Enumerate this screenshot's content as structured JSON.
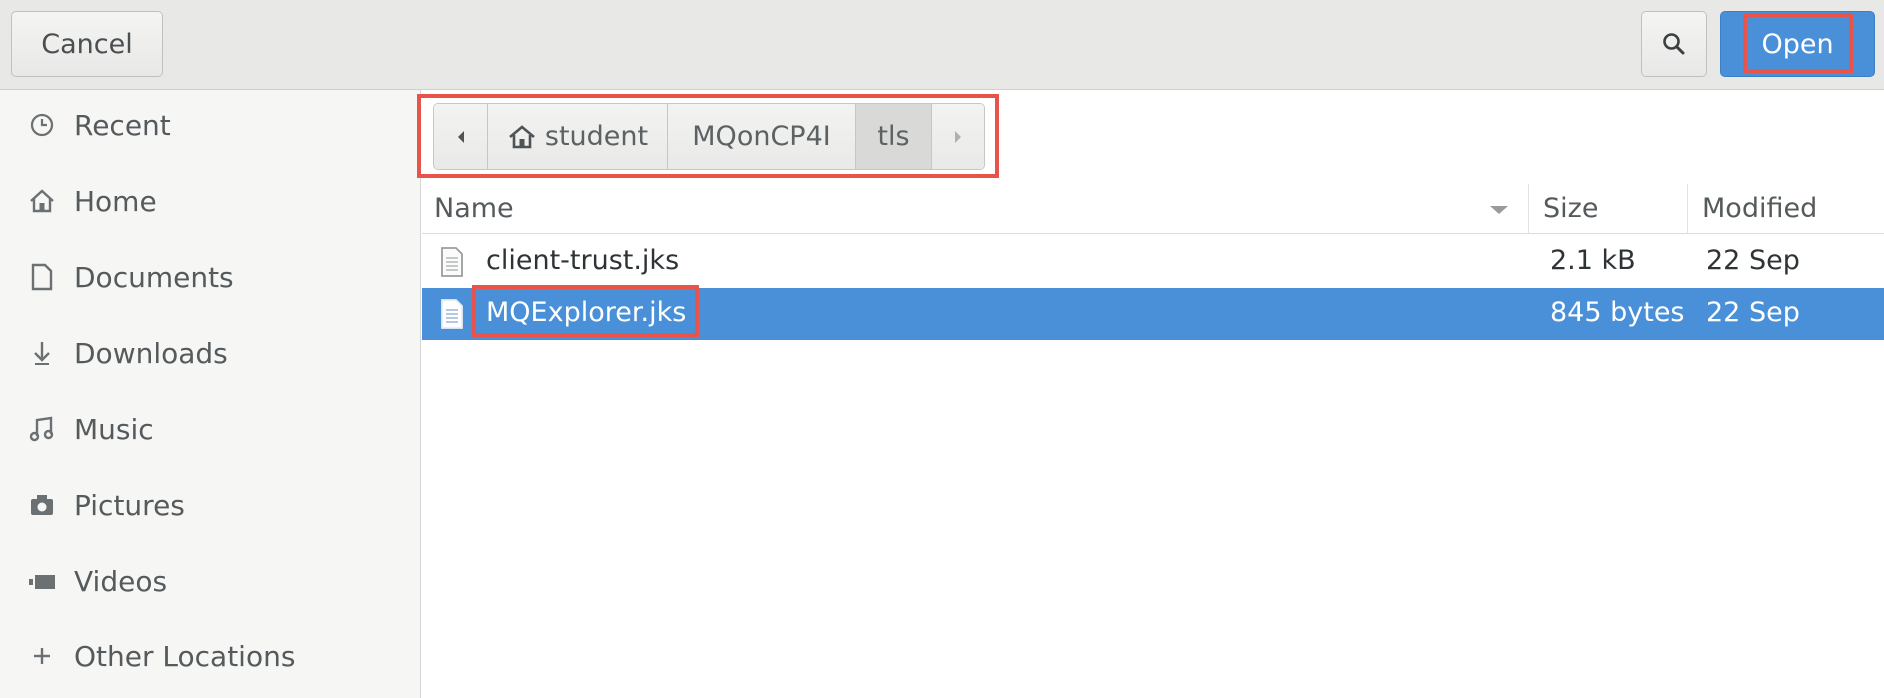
{
  "header": {
    "cancel_label": "Cancel",
    "search_icon": "search-icon",
    "open_label": "Open"
  },
  "sidebar": {
    "items": [
      {
        "label": "Recent",
        "icon": "clock-icon"
      },
      {
        "label": "Home",
        "icon": "home-icon"
      },
      {
        "label": "Documents",
        "icon": "document-icon"
      },
      {
        "label": "Downloads",
        "icon": "download-icon"
      },
      {
        "label": "Music",
        "icon": "music-icon"
      },
      {
        "label": "Pictures",
        "icon": "camera-icon"
      },
      {
        "label": "Videos",
        "icon": "video-icon"
      },
      {
        "label": "Other Locations",
        "icon": "plus-icon"
      }
    ]
  },
  "pathbar": {
    "segments": [
      "student",
      "MQonCP4I",
      "tls"
    ],
    "current": "tls"
  },
  "filelist": {
    "columns": [
      "Name",
      "Size",
      "Modified"
    ],
    "rows": [
      {
        "name": "client-trust.jks",
        "size": "2.1 kB",
        "modified": "22 Sep",
        "selected": false
      },
      {
        "name": "MQExplorer.jks",
        "size": "845 bytes",
        "modified": "22 Sep",
        "selected": true
      }
    ]
  },
  "colors": {
    "accent": "#4a90d9",
    "highlight": "#e8534a"
  }
}
